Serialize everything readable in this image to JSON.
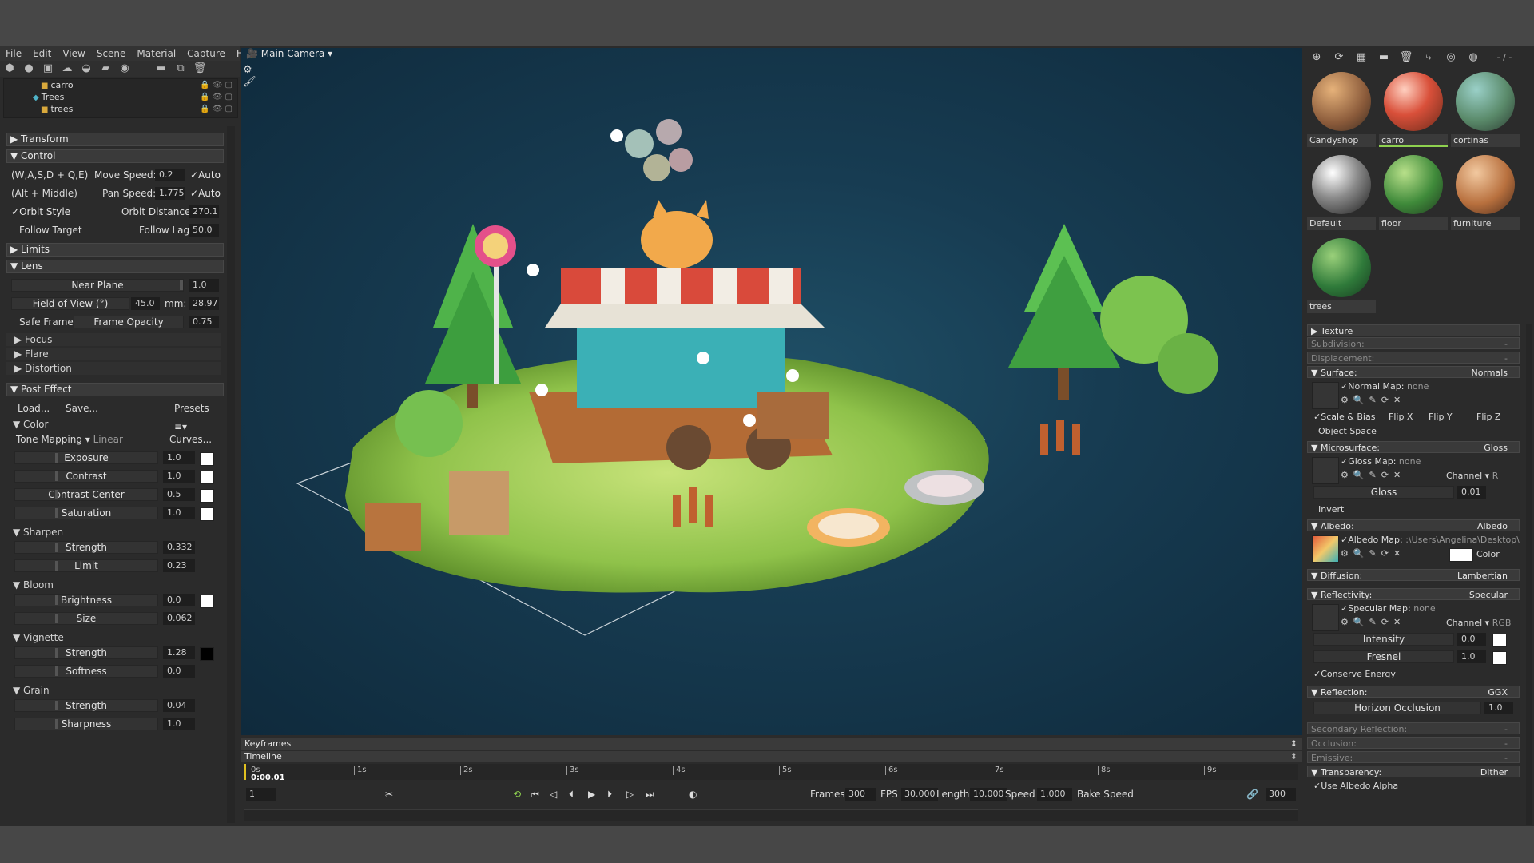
{
  "menu": [
    "File",
    "Edit",
    "View",
    "Scene",
    "Material",
    "Capture",
    "Help"
  ],
  "scene_tree": [
    {
      "label": "carro",
      "icon": "object"
    },
    {
      "label": "Trees",
      "icon": "group"
    },
    {
      "label": "trees",
      "icon": "object"
    }
  ],
  "left": {
    "transform": "Transform",
    "control": "Control",
    "ctrl_rows": {
      "wasd": "(W,A,S,D + Q,E)",
      "move_speed_label": "Move Speed:",
      "move_speed": "0.2",
      "auto1": "Auto",
      "altmid": "(Alt + Middle)",
      "pan_speed_label": "Pan Speed:",
      "pan_speed": "1.775",
      "auto2": "Auto",
      "orbit_style": "Orbit Style",
      "orbit_dist_label": "Orbit Distance:",
      "orbit_dist": "270.1",
      "follow_target": "Follow Target",
      "follow_lag_label": "Follow Lag",
      "follow_lag": "50.0"
    },
    "limits": "Limits",
    "lens": "Lens",
    "lens_rows": {
      "near_label": "Near Plane",
      "near": "1.0",
      "fov_label": "Field of View (°)",
      "fov": "45.0",
      "mm_label": "mm:",
      "mm": "28.97",
      "safe_frame": "Safe Frame",
      "frame_opacity_label": "Frame Opacity",
      "frame_opacity": "0.75"
    },
    "focus": "Focus",
    "flare": "Flare",
    "distortion": "Distortion",
    "post_effect": "Post Effect",
    "load": "Load...",
    "save": "Save...",
    "presets": "Presets",
    "color": "Color",
    "tone_mapping": "Tone Mapping",
    "tone_value": "Linear",
    "curves": "Curves...",
    "color_rows": [
      {
        "label": "Exposure",
        "value": "1.0"
      },
      {
        "label": "Contrast",
        "value": "1.0"
      },
      {
        "label": "Contrast Center",
        "value": "0.5"
      },
      {
        "label": "Saturation",
        "value": "1.0"
      }
    ],
    "sharpen": "Sharpen",
    "sharpen_rows": [
      {
        "label": "Strength",
        "value": "0.332"
      },
      {
        "label": "Limit",
        "value": "0.23"
      }
    ],
    "bloom": "Bloom",
    "bloom_rows": [
      {
        "label": "Brightness",
        "value": "0.0"
      },
      {
        "label": "Size",
        "value": "0.062"
      }
    ],
    "vignette": "Vignette",
    "vignette_rows": [
      {
        "label": "Strength",
        "value": "1.28"
      },
      {
        "label": "Softness",
        "value": "0.0"
      }
    ],
    "grain": "Grain",
    "grain_rows": [
      {
        "label": "Strength",
        "value": "0.04"
      },
      {
        "label": "Sharpness",
        "value": "1.0"
      }
    ]
  },
  "viewport": {
    "camera": "Main Camera"
  },
  "timeline": {
    "keyframes": "Keyframes",
    "timeline": "Timeline",
    "ticks": [
      "0s",
      "1s",
      "2s",
      "3s",
      "4s",
      "5s",
      "6s",
      "7s",
      "8s",
      "9s"
    ],
    "current_time": "0:00.01",
    "frame_field": "1",
    "frames_label": "Frames",
    "frames": "300",
    "fps_label": "FPS",
    "fps": "30.000",
    "length_label": "Length",
    "length": "10.000",
    "speed_label": "Speed",
    "speed": "1.000",
    "bake_speed": "Bake Speed",
    "end_frame": "300"
  },
  "right": {
    "tool_page": "- / -",
    "materials": [
      {
        "name": "Candyshop",
        "selected": false
      },
      {
        "name": "carro",
        "selected": true
      },
      {
        "name": "cortinas",
        "selected": false
      },
      {
        "name": "Default",
        "selected": false
      },
      {
        "name": "floor",
        "selected": false
      },
      {
        "name": "furniture",
        "selected": false
      },
      {
        "name": "trees",
        "selected": false
      }
    ],
    "texture": "Texture",
    "subdivision": "Subdivision:",
    "subdivision_v": "-",
    "displacement": "Displacement:",
    "displacement_v": "-",
    "surface": "Surface:",
    "surface_v": "Normals",
    "normal_map": "Normal Map:",
    "normal_map_v": "none",
    "scale_bias": "Scale & Bias",
    "flip_x": "Flip X",
    "flip_y": "Flip Y",
    "flip_z": "Flip Z",
    "object_space": "Object Space",
    "microsurface": "Microsurface:",
    "microsurface_v": "Gloss",
    "gloss_map": "Gloss Map:",
    "gloss_map_v": "none",
    "channel_label": "Channel",
    "channel_r": "R",
    "gloss": "Gloss",
    "gloss_v": "0.01",
    "invert": "Invert",
    "albedo": "Albedo:",
    "albedo_v": "Albedo",
    "albedo_map": "Albedo Map:",
    "albedo_map_v": ":\\Users\\Angelina\\Desktop\\",
    "color_label": "Color",
    "diffusion": "Diffusion:",
    "diffusion_v": "Lambertian",
    "reflectivity": "Reflectivity:",
    "reflectivity_v": "Specular",
    "specular_map": "Specular Map:",
    "specular_map_v": "none",
    "channel_rgb": "RGB",
    "intensity": "Intensity",
    "intensity_v": "0.0",
    "fresnel": "Fresnel",
    "fresnel_v": "1.0",
    "conserve": "Conserve Energy",
    "reflection": "Reflection:",
    "reflection_v": "GGX",
    "horizon": "Horizon Occlusion",
    "horizon_v": "1.0",
    "secondary": "Secondary Reflection:",
    "secondary_v": "-",
    "occlusion": "Occlusion:",
    "occlusion_v": "-",
    "emissive": "Emissive:",
    "emissive_v": "-",
    "transparency": "Transparency:",
    "transparency_v": "Dither",
    "use_albedo_alpha": "Use Albedo Alpha"
  }
}
